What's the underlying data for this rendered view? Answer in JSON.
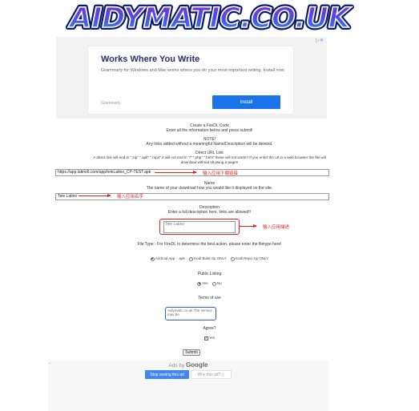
{
  "logo": {
    "text": "AIDYMATIC.CO.UK"
  },
  "ad": {
    "choices": "▷✕",
    "title": "Works Where You Write",
    "description": "Grammarly for Windows and Mac works where you do your most important writing. Install now.",
    "brand": "Grammarly",
    "button": "Install"
  },
  "form": {
    "heading": "Create a FireDL Code",
    "instruction": "Enter all the information below and press submit!",
    "note_label": "NOTE!",
    "note_text": "Any links added without a meaningful Name/Description will be deleted.",
    "url_label": "Direct URL Link",
    "url_help_1": "A direct link will end in \".zip\" \".apk\" \".mp4\" it will not end in \"/\" \".php\" \".html\" these will not work!!! If you enter the url in a web browser the file will",
    "url_help_2": "download without showing a page!!",
    "url_value": "https://app.latino6.com/app/teleLatino_CP-TEST.apk",
    "url_annotation": "输入应用下载链接",
    "name_label": "Name",
    "name_help": "The name of your download how you would like it displayed on the site.",
    "name_value": "Tele Latino",
    "name_annotation": "输入应用名字",
    "desc_label": "Description",
    "desc_help": "Enter a full description here, links are allowed!!",
    "desc_value": "Tele Latino",
    "desc_annotation": "输入应用描述",
    "filetype_label": "File Type - For FireDL to determine the best action, please enter the filetype here!",
    "filetype_options": [
      "Android App - .apk",
      "Kodi Build zip ONLY",
      "Kodi Repo zip ONLY"
    ],
    "public_label": "Public Listing",
    "public_options": [
      "Yes",
      "No"
    ],
    "terms_label": "Terms of use",
    "terms_text": "Aidymatic.co.uk The service may be",
    "agree_label": "Agree?",
    "agree_option": "Yes",
    "submit_label": "Submit"
  },
  "bottom_ad": {
    "ads_by": "Ads by",
    "google": "Google",
    "stop_label": "Stop seeing this ad",
    "why_label": "Why this ad? ▷",
    "back_icon": "←"
  }
}
